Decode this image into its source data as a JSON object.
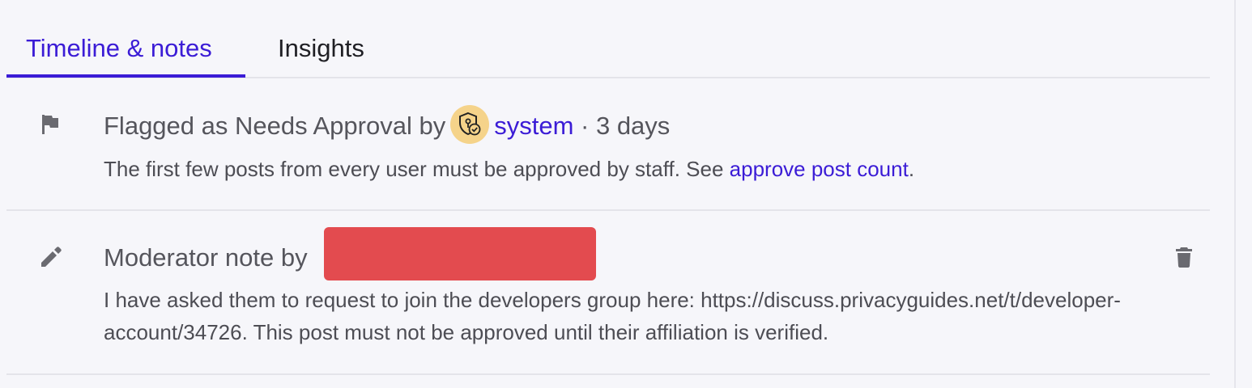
{
  "tabs": {
    "timeline_label": "Timeline & notes",
    "insights_label": "Insights"
  },
  "entries": [
    {
      "icon": "flag-icon",
      "title_prefix": "Flagged as Needs Approval by",
      "username": "system",
      "time": "· 3 days",
      "description_prefix": "The first few posts from every user must be approved by staff. See",
      "description_link": "approve post count",
      "description_suffix": "."
    },
    {
      "icon": "pencil-icon",
      "title_prefix": "Moderator note by",
      "body": "I have asked them to request to join the developers group here: https://discuss.privacyguides.net/t/developer-account/34726. This post must not be approved until their affiliation is verified."
    }
  ],
  "colors": {
    "accent": "#3b1cd6",
    "redaction": "#e34b4f",
    "avatar_bg": "#f5d38a"
  }
}
